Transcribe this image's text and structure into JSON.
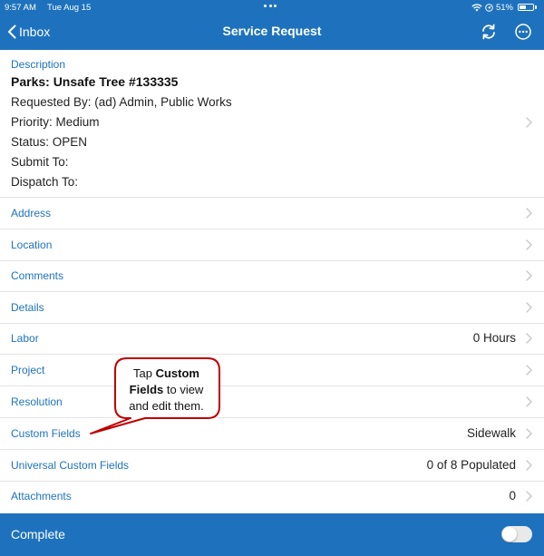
{
  "status_bar": {
    "time": "9:57 AM",
    "date": "Tue Aug 15",
    "battery_text": "51%",
    "battery_level": 0.51,
    "icons": [
      "wifi-icon",
      "location-icon",
      "battery-icon"
    ]
  },
  "nav": {
    "back_label": "Inbox",
    "title": "Service Request",
    "icons": [
      "refresh-icon",
      "more-icon"
    ]
  },
  "header": {
    "section_label": "Description",
    "title": "Parks: Unsafe Tree #133335",
    "requested_by": "Requested By: (ad) Admin, Public Works",
    "priority": "Priority: Medium",
    "status": "Status: OPEN",
    "submit_to": "Submit To:",
    "dispatch_to": "Dispatch To:"
  },
  "rows": [
    {
      "label": "Address",
      "value": ""
    },
    {
      "label": "Location",
      "value": ""
    },
    {
      "label": "Comments",
      "value": ""
    },
    {
      "label": "Details",
      "value": ""
    },
    {
      "label": "Labor",
      "value": "0 Hours"
    },
    {
      "label": "Project",
      "value": ""
    },
    {
      "label": "Resolution",
      "value": ""
    },
    {
      "label": "Custom Fields",
      "value": "Sidewalk"
    },
    {
      "label": "Universal Custom Fields",
      "value": "0 of 8 Populated"
    },
    {
      "label": "Attachments",
      "value": "0"
    }
  ],
  "footer": {
    "label": "Complete",
    "toggle_on": false
  },
  "callout": {
    "text_1": "Tap ",
    "bold_1": "Custom",
    "bold_2": "Fields",
    "text_2": " to view",
    "text_3": "and edit them."
  },
  "colors": {
    "brand_blue": "#1e72bd",
    "callout_border": "#c00000",
    "chevron": "#c7c7cc",
    "divider": "#e3e3e3"
  }
}
